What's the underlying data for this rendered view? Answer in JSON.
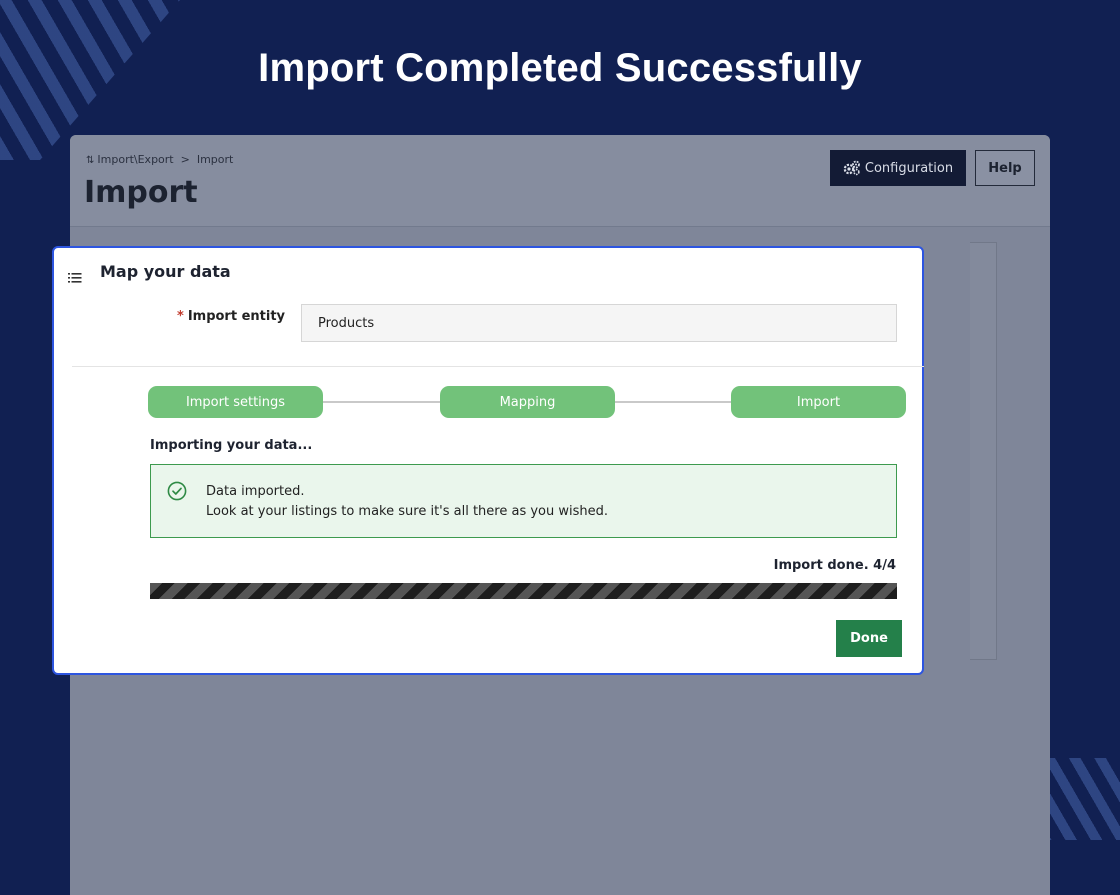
{
  "headline": "Import Completed Successfully",
  "page": {
    "breadcrumb": {
      "parent": "Import\\Export",
      "separator": ">",
      "current": "Import"
    },
    "title": "Import",
    "config_button": "Configuration",
    "help_button": "Help"
  },
  "modal": {
    "title": "Map your data",
    "entity": {
      "label": "Import entity",
      "required_marker": "*",
      "value": "Products"
    },
    "steps": [
      {
        "label": "Import settings"
      },
      {
        "label": "Mapping"
      },
      {
        "label": "Import"
      }
    ],
    "importing_title": "Importing your data...",
    "alert": {
      "line1": "Data imported.",
      "line2": "Look at your listings to make sure it's all there as you wished."
    },
    "progress": {
      "status": "Import done. 4/4",
      "percent": 100
    },
    "done_button": "Done"
  },
  "colors": {
    "background": "#112052",
    "step": "#72c27a",
    "success_border": "#3d9a4e",
    "success_bg": "#eaf6ec",
    "done_button": "#24804a",
    "modal_border": "#2d55e0"
  },
  "icons": {
    "breadcrumb": "sort-arrows-icon",
    "config": "gears-icon",
    "modal_title": "list-icon",
    "alert": "check-circle-icon"
  }
}
